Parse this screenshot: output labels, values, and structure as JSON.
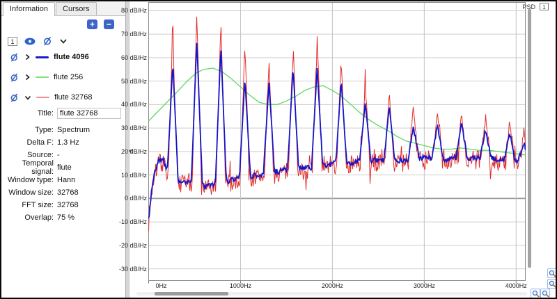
{
  "left_panel": {
    "tabs": [
      {
        "label": "Information",
        "selected": true
      },
      {
        "label": "Cursors",
        "selected": false
      }
    ],
    "add_button_label": "+",
    "remove_button_label": "−",
    "toolbar": {
      "index_badge": "1",
      "icons": [
        "eye-icon",
        "eye-off-icon",
        "chevron-down-icon"
      ]
    },
    "legend": [
      {
        "label": "flute 4096",
        "color": "#1c1ccd",
        "bold": true,
        "expanded": false,
        "line_width": 3
      },
      {
        "label": "flute 256",
        "color": "#7de07d",
        "bold": false,
        "expanded": false,
        "line_width": 2
      },
      {
        "label": "flute 32768",
        "color": "#f29090",
        "bold": false,
        "expanded": true,
        "line_width": 2
      }
    ],
    "fields": [
      {
        "label": "Title:",
        "value": "flute 32768",
        "input": true
      },
      {
        "label": "Type:",
        "value": "Spectrum"
      },
      {
        "label": "Delta F:",
        "value": "1.3 Hz"
      },
      {
        "label": "Source:",
        "value": "-"
      },
      {
        "label": "Temporal signal:",
        "value": "flute"
      },
      {
        "label": "Window type:",
        "value": "Hann"
      },
      {
        "label": "Window size:",
        "value": "32768"
      },
      {
        "label": "FFT size:",
        "value": "32768"
      },
      {
        "label": "Overlap:",
        "value": "75 %"
      }
    ]
  },
  "splitter": {
    "collapse_label": "<"
  },
  "chart": {
    "header_label": "PSD",
    "header_index": "1"
  },
  "chart_data": {
    "type": "line",
    "title": "PSD",
    "x_unit": "Hz",
    "y_unit": "dB/Hz",
    "xlim": [
      0,
      4100
    ],
    "ylim": [
      -35,
      83.5
    ],
    "x_ticks": [
      0,
      1000,
      2000,
      3000,
      4000
    ],
    "x_tick_labels": [
      "0Hz",
      "1000Hz",
      "2000Hz",
      "3000Hz",
      "4000Hz"
    ],
    "y_ticks": [
      80,
      70,
      60,
      50,
      40,
      30,
      20,
      10,
      0,
      -10,
      -20,
      -30
    ],
    "y_tick_labels": [
      "80 dB/Hz",
      "70 dB/Hz",
      "60 dB/Hz",
      "50 dB/Hz",
      "40 dB/Hz",
      "30 dB/Hz",
      "20 dB/Hz",
      "10 dB/Hz",
      "0 dB/Hz",
      "-10 dB/Hz",
      "-20 dB/Hz",
      "-30 dB/Hz"
    ],
    "emphasized_y_gridline": 0,
    "grid": true,
    "series": [
      {
        "name": "flute 4096",
        "color": "#1515c8",
        "stroke_width": 1.8,
        "draw_order": 2,
        "seed": 3,
        "jitter_db": 1.2,
        "halfwidth_hz": 60,
        "baseline": [
          [
            0,
            -9
          ],
          [
            25,
            1
          ],
          [
            60,
            11
          ],
          [
            110,
            16
          ],
          [
            160,
            16.5
          ],
          [
            205,
            11
          ],
          [
            240,
            8
          ],
          [
            330,
            7
          ],
          [
            430,
            6.5
          ],
          [
            560,
            6
          ],
          [
            660,
            5
          ],
          [
            780,
            6.5
          ],
          [
            900,
            8
          ],
          [
            1000,
            9
          ],
          [
            1120,
            9.5
          ],
          [
            1230,
            10.5
          ],
          [
            1350,
            11
          ],
          [
            1470,
            12
          ],
          [
            1600,
            12.5
          ],
          [
            1720,
            13
          ],
          [
            1850,
            13.5
          ],
          [
            1970,
            14.5
          ],
          [
            2100,
            15
          ],
          [
            2230,
            15.5
          ],
          [
            2360,
            16
          ],
          [
            2500,
            16.5
          ],
          [
            2640,
            16
          ],
          [
            2780,
            16.5
          ],
          [
            2920,
            17
          ],
          [
            3060,
            17.5
          ],
          [
            3200,
            16.5
          ],
          [
            3340,
            17.5
          ],
          [
            3480,
            17
          ],
          [
            3620,
            17.5
          ],
          [
            3760,
            17
          ],
          [
            3900,
            16
          ],
          [
            3990,
            15.5
          ],
          [
            4040,
            17
          ],
          [
            4100,
            12.5
          ]
        ],
        "harmonics": [
          [
            262,
            58
          ],
          [
            524,
            67.5
          ],
          [
            786,
            64.8
          ],
          [
            1048,
            51
          ],
          [
            1310,
            49.8
          ],
          [
            1572,
            55.7
          ],
          [
            1834,
            55.7
          ],
          [
            2096,
            50
          ],
          [
            2358,
            41
          ],
          [
            2620,
            39.5
          ],
          [
            2882,
            30.8
          ],
          [
            3144,
            31.5
          ],
          [
            3406,
            32.5
          ],
          [
            3668,
            29
          ],
          [
            3930,
            27.5
          ],
          [
            4085,
            24
          ]
        ]
      },
      {
        "name": "flute 256",
        "color": "#5fd75f",
        "stroke_width": 1.3,
        "draw_order": 0,
        "points": [
          [
            0,
            33
          ],
          [
            100,
            37
          ],
          [
            200,
            41
          ],
          [
            300,
            45
          ],
          [
            420,
            50
          ],
          [
            520,
            53.5
          ],
          [
            600,
            55
          ],
          [
            700,
            55.5
          ],
          [
            800,
            54
          ],
          [
            900,
            51
          ],
          [
            1000,
            47.5
          ],
          [
            1100,
            44
          ],
          [
            1200,
            41
          ],
          [
            1300,
            40
          ],
          [
            1400,
            40
          ],
          [
            1500,
            41.5
          ],
          [
            1600,
            43.5
          ],
          [
            1700,
            46
          ],
          [
            1800,
            47.5
          ],
          [
            1900,
            48
          ],
          [
            2000,
            46
          ],
          [
            2100,
            43.5
          ],
          [
            2200,
            40
          ],
          [
            2300,
            36.5
          ],
          [
            2400,
            33.5
          ],
          [
            2500,
            31
          ],
          [
            2600,
            29
          ],
          [
            2700,
            26.5
          ],
          [
            2800,
            24.5
          ],
          [
            2900,
            23.5
          ],
          [
            3000,
            22.5
          ],
          [
            3100,
            21.5
          ],
          [
            3200,
            21
          ],
          [
            3300,
            21
          ],
          [
            3400,
            21.5
          ],
          [
            3500,
            21
          ],
          [
            3600,
            20.5
          ],
          [
            3700,
            20.5
          ],
          [
            3800,
            20
          ],
          [
            3900,
            19.5
          ],
          [
            4000,
            19
          ],
          [
            4100,
            18.5
          ]
        ]
      },
      {
        "name": "flute 32768",
        "color": "#e12d2d",
        "stroke_width": 1,
        "draw_order": 1,
        "seed": 7,
        "jitter_db": 4,
        "spike_db": 7,
        "halfwidth_hz": 52,
        "baseline": [
          [
            0,
            -10
          ],
          [
            25,
            0
          ],
          [
            60,
            10
          ],
          [
            110,
            15
          ],
          [
            160,
            15.5
          ],
          [
            205,
            10
          ],
          [
            240,
            7
          ],
          [
            330,
            6
          ],
          [
            430,
            5.5
          ],
          [
            560,
            5
          ],
          [
            660,
            4
          ],
          [
            780,
            5.5
          ],
          [
            900,
            7
          ],
          [
            1000,
            8
          ],
          [
            1120,
            8.5
          ],
          [
            1230,
            9.5
          ],
          [
            1350,
            10
          ],
          [
            1470,
            11
          ],
          [
            1600,
            11.5
          ],
          [
            1720,
            12
          ],
          [
            1850,
            12.5
          ],
          [
            1970,
            13.5
          ],
          [
            2100,
            14
          ],
          [
            2230,
            14.5
          ],
          [
            2360,
            15
          ],
          [
            2500,
            15.5
          ],
          [
            2640,
            15
          ],
          [
            2780,
            15.5
          ],
          [
            2920,
            16
          ],
          [
            3060,
            16.5
          ],
          [
            3200,
            15.5
          ],
          [
            3340,
            16.5
          ],
          [
            3480,
            16
          ],
          [
            3620,
            16.5
          ],
          [
            3760,
            16
          ],
          [
            3900,
            15
          ],
          [
            3990,
            14.5
          ],
          [
            4040,
            16
          ],
          [
            4100,
            11.5
          ]
        ],
        "harmonics": [
          [
            262,
            70.5
          ],
          [
            524,
            79
          ],
          [
            786,
            75.5
          ],
          [
            1048,
            66
          ],
          [
            1310,
            58
          ],
          [
            1572,
            65
          ],
          [
            1834,
            69.5
          ],
          [
            2096,
            59
          ],
          [
            2358,
            48.5
          ],
          [
            2620,
            44.5
          ],
          [
            2882,
            39.5
          ],
          [
            3144,
            37.5
          ],
          [
            3406,
            36
          ],
          [
            3668,
            34.5
          ],
          [
            3930,
            33
          ],
          [
            4085,
            30
          ]
        ]
      }
    ]
  }
}
